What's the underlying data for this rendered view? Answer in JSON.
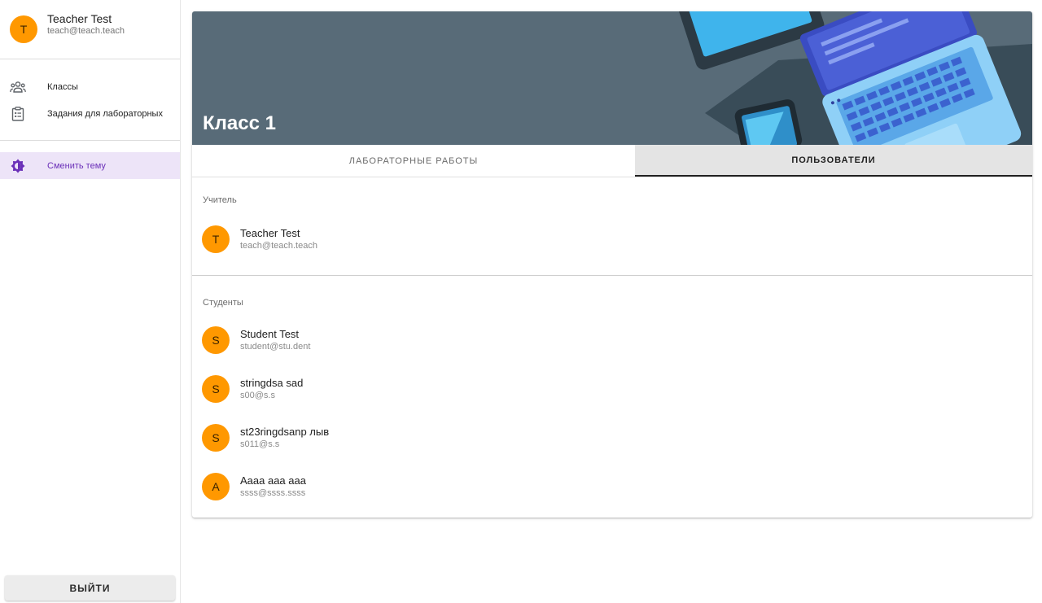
{
  "user": {
    "initial": "T",
    "name": "Teacher Test",
    "email": "teach@teach.teach"
  },
  "nav": {
    "items": [
      {
        "label": "Классы",
        "icon": "groups-icon"
      },
      {
        "label": "Задания для лабораторных",
        "icon": "clipboard-icon"
      }
    ],
    "theme_toggle": {
      "label": "Сменить тему",
      "icon": "brightness-icon"
    }
  },
  "logout_label": "ВЫЙТИ",
  "class": {
    "title": "Класс 1",
    "tabs": [
      {
        "label": "ЛАБОРАТОРНЫЕ РАБОТЫ",
        "active": false
      },
      {
        "label": "ПОЛЬЗОВАТЕЛИ",
        "active": true
      }
    ],
    "teacher_heading": "Учитель",
    "teacher": {
      "initial": "T",
      "name": "Teacher Test",
      "email": "teach@teach.teach"
    },
    "students_heading": "Студенты",
    "students": [
      {
        "initial": "S",
        "name": "Student Test",
        "email": "student@stu.dent"
      },
      {
        "initial": "S",
        "name": "stringdsa sad",
        "email": "s00@s.s"
      },
      {
        "initial": "S",
        "name": "st23ringdsanp лыв",
        "email": "s011@s.s"
      },
      {
        "initial": "A",
        "name": "Aaaa aaa aaa",
        "email": "ssss@ssss.ssss"
      }
    ]
  },
  "colors": {
    "accent": "#6a2fb8",
    "avatar": "#ff9800",
    "banner": "#586b78",
    "theme_highlight": "#ede4f8"
  }
}
